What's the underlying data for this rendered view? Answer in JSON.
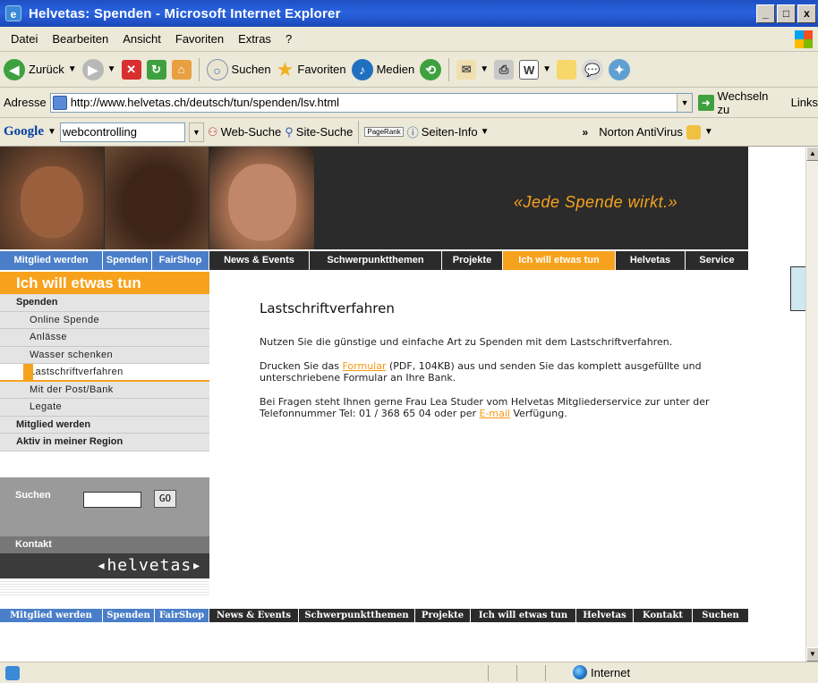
{
  "window": {
    "title": "Helvetas: Spenden - Microsoft Internet Explorer",
    "buttons": [
      "_",
      "□",
      "x"
    ]
  },
  "menu": [
    "Datei",
    "Bearbeiten",
    "Ansicht",
    "Favoriten",
    "Extras",
    "?"
  ],
  "toolbar": {
    "back": "Zurück",
    "search": "Suchen",
    "favorites": "Favoriten",
    "media": "Medien"
  },
  "address": {
    "label": "Adresse",
    "url": "http://www.helvetas.ch/deutsch/tun/spenden/lsv.html",
    "go": "Wechseln zu",
    "links": "Links"
  },
  "google": {
    "logo": "Google",
    "query": "webcontrolling",
    "web_search": "Web-Suche",
    "site_search": "Site-Suche",
    "pagerank": "PageRank",
    "page_info": "Seiten-Info",
    "more": "»",
    "norton": "Norton AntiVirus"
  },
  "header": {
    "tagline": "«Jede Spende wirkt.»"
  },
  "topnav": [
    "Mitglied werden",
    "Spenden",
    "FairShop",
    "News & Events",
    "Schwerpunktthemen",
    "Projekte",
    "Ich will etwas tun",
    "Helvetas",
    "Service"
  ],
  "sidebar": {
    "title": "Ich will etwas tun",
    "items": [
      {
        "label": "Spenden"
      },
      {
        "label": "Online Spende"
      },
      {
        "label": "Anlässe"
      },
      {
        "label": "Wasser schenken"
      },
      {
        "label": "Lastschriftverfahren"
      },
      {
        "label": "Mit der Post/Bank"
      },
      {
        "label": "Legate"
      },
      {
        "label": "Mitglied werden"
      },
      {
        "label": "Aktiv in meiner Region"
      }
    ],
    "search_label": "Suchen",
    "search_button": "GO",
    "contact": "Kontakt",
    "logo": "◂helvetas▸"
  },
  "content": {
    "heading": "Lastschriftverfahren",
    "p1": "Nutzen Sie die günstige und einfache Art zu Spenden mit dem Lastschriftverfahren.",
    "p2_before": "Drucken Sie das ",
    "p2_link": "Formular",
    "p2_after": " (PDF, 104KB) aus und senden Sie das komplett ausgefüllte und unterschriebene Formular an Ihre Bank.",
    "p3_before": "Bei Fragen steht Ihnen gerne Frau Lea Studer vom Helvetas Mitgliederservice zur unter der Telefonnummer Tel: 01 / 368 65 04 oder per ",
    "p3_link": "E-mail",
    "p3_after": " Verfügung."
  },
  "bottomnav": [
    "Mitglied werden",
    "Spenden",
    "FairShop",
    "News & Events",
    "Schwerpunktthemen",
    "Projekte",
    "Ich will etwas tun",
    "Helvetas",
    "Kontakt",
    "Suchen"
  ],
  "status": {
    "zone": "Internet"
  },
  "colors": {
    "orange": "#f7a21c",
    "blue": "#4a7ec8",
    "dark": "#2b2b2b"
  }
}
